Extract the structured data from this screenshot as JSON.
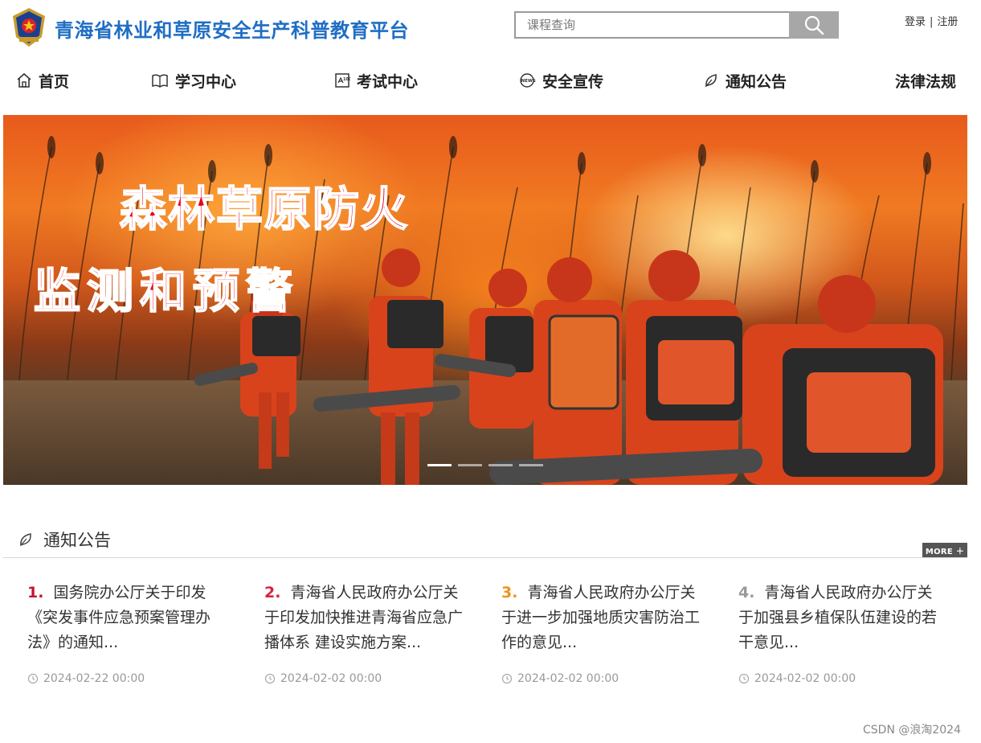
{
  "header": {
    "site_title": "青海省林业和草原安全生产科普教育平台",
    "search_placeholder": "课程查询",
    "login": "登录",
    "separator": "|",
    "register": "注册"
  },
  "nav": {
    "items": [
      {
        "label": "首页",
        "icon": "home-icon"
      },
      {
        "label": "学习中心",
        "icon": "book-icon"
      },
      {
        "label": "考试中心",
        "icon": "exam-icon"
      },
      {
        "label": "安全宣传",
        "icon": "news-icon"
      },
      {
        "label": "通知公告",
        "icon": "leaf-icon"
      },
      {
        "label": "法律法规",
        "icon": ""
      }
    ]
  },
  "banner": {
    "line1": "森林草原防火",
    "line2": "监测和预警",
    "slide_count": 4,
    "active_slide": 1
  },
  "notices": {
    "title": "通知公告",
    "more_label": "MORE ＋",
    "items": [
      {
        "num": "1.",
        "num_color": "#c0182e",
        "title": "国务院办公厅关于印发《突发事件应急预案管理办法》的通知...",
        "date": "2024-02-22 00:00"
      },
      {
        "num": "2.",
        "num_color": "#d6233f",
        "title": "青海省人民政府办公厅关于印发加快推进青海省应急广播体系 建设实施方案...",
        "date": "2024-02-02 00:00"
      },
      {
        "num": "3.",
        "num_color": "#f0931e",
        "title": "青海省人民政府办公厅关于进一步加强地质灾害防治工作的意见...",
        "date": "2024-02-02 00:00"
      },
      {
        "num": "4.",
        "num_color": "#9a9a9a",
        "title": "青海省人民政府办公厅关于加强县乡植保队伍建设的若干意见...",
        "date": "2024-02-02 00:00"
      }
    ]
  },
  "watermark": "CSDN @浪淘2024",
  "colors": {
    "title_blue": "#1f6ec3",
    "banner_text_red": "#e5001d",
    "more_bg": "#555555"
  }
}
